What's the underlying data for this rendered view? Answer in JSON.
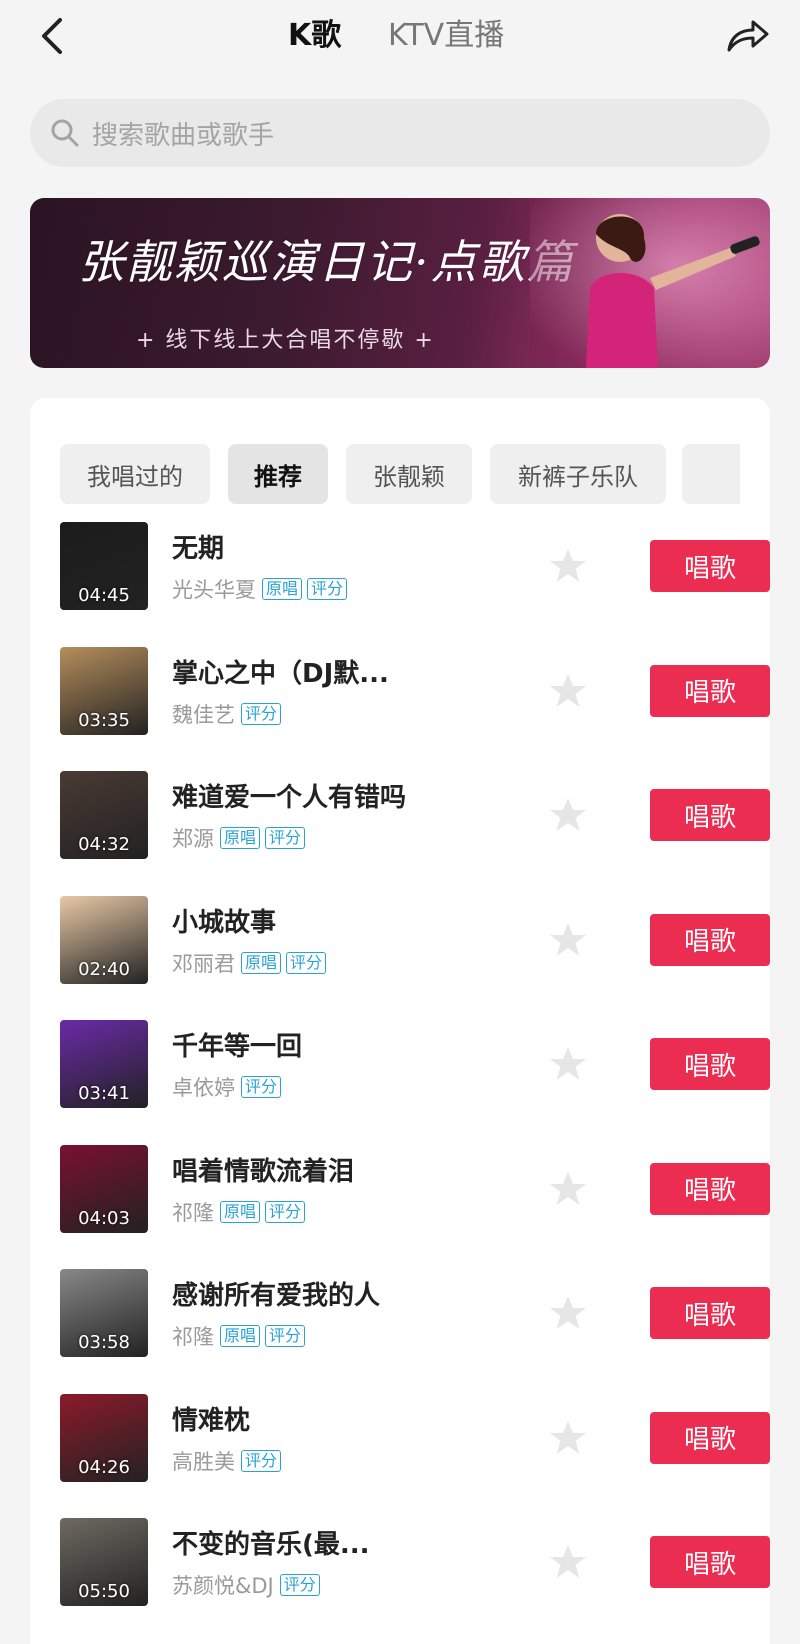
{
  "header": {
    "tabs": [
      {
        "label": "K歌",
        "active": true
      },
      {
        "label": "KTV直播",
        "active": false
      }
    ]
  },
  "search": {
    "placeholder": "搜索歌曲或歌手"
  },
  "banner": {
    "title": "张靓颖巡演日记·点歌篇",
    "subtitle": "+ 线下线上大合唱不停歇 +"
  },
  "chips": [
    {
      "label": "我唱过的",
      "selected": false
    },
    {
      "label": "推荐",
      "selected": true
    },
    {
      "label": "张靓颖",
      "selected": false
    },
    {
      "label": "新裤子乐队",
      "selected": false
    }
  ],
  "songs": [
    {
      "title": "无期",
      "artist": "光头华夏",
      "tags": [
        "原唱",
        "评分"
      ],
      "duration": "04:45",
      "cover_color": "#1c1c1c"
    },
    {
      "title": "掌心之中（DJ默...",
      "artist": "魏佳艺",
      "tags": [
        "评分"
      ],
      "duration": "03:35",
      "cover_color": "#b58e5c"
    },
    {
      "title": "难道爱一个人有错吗",
      "artist": "郑源",
      "tags": [
        "原唱",
        "评分"
      ],
      "duration": "04:32",
      "cover_color": "#4a3a34"
    },
    {
      "title": "小城故事",
      "artist": "邓丽君",
      "tags": [
        "原唱",
        "评分"
      ],
      "duration": "02:40",
      "cover_color": "#e8c9a6"
    },
    {
      "title": "千年等一回",
      "artist": "卓依婷",
      "tags": [
        "评分"
      ],
      "duration": "03:41",
      "cover_color": "#6a2aa8"
    },
    {
      "title": "唱着情歌流着泪",
      "artist": "祁隆",
      "tags": [
        "原唱",
        "评分"
      ],
      "duration": "04:03",
      "cover_color": "#7a1030"
    },
    {
      "title": "感谢所有爱我的人",
      "artist": "祁隆",
      "tags": [
        "原唱",
        "评分"
      ],
      "duration": "03:58",
      "cover_color": "#888888"
    },
    {
      "title": "情难枕",
      "artist": "高胜美",
      "tags": [
        "评分"
      ],
      "duration": "04:26",
      "cover_color": "#8c1a2a"
    },
    {
      "title": "不变的音乐(最...",
      "artist": "苏颜悦&DJ",
      "tags": [
        "评分"
      ],
      "duration": "05:50",
      "cover_color": "#6e6a62"
    }
  ],
  "sing_button_label": "唱歌",
  "colors": {
    "accent": "#ec2d52",
    "tag": "#2aa2d6"
  },
  "icons": {
    "back": "chevron-left-icon",
    "share": "share-arrow-icon",
    "search": "search-icon",
    "favorite": "star-icon"
  }
}
